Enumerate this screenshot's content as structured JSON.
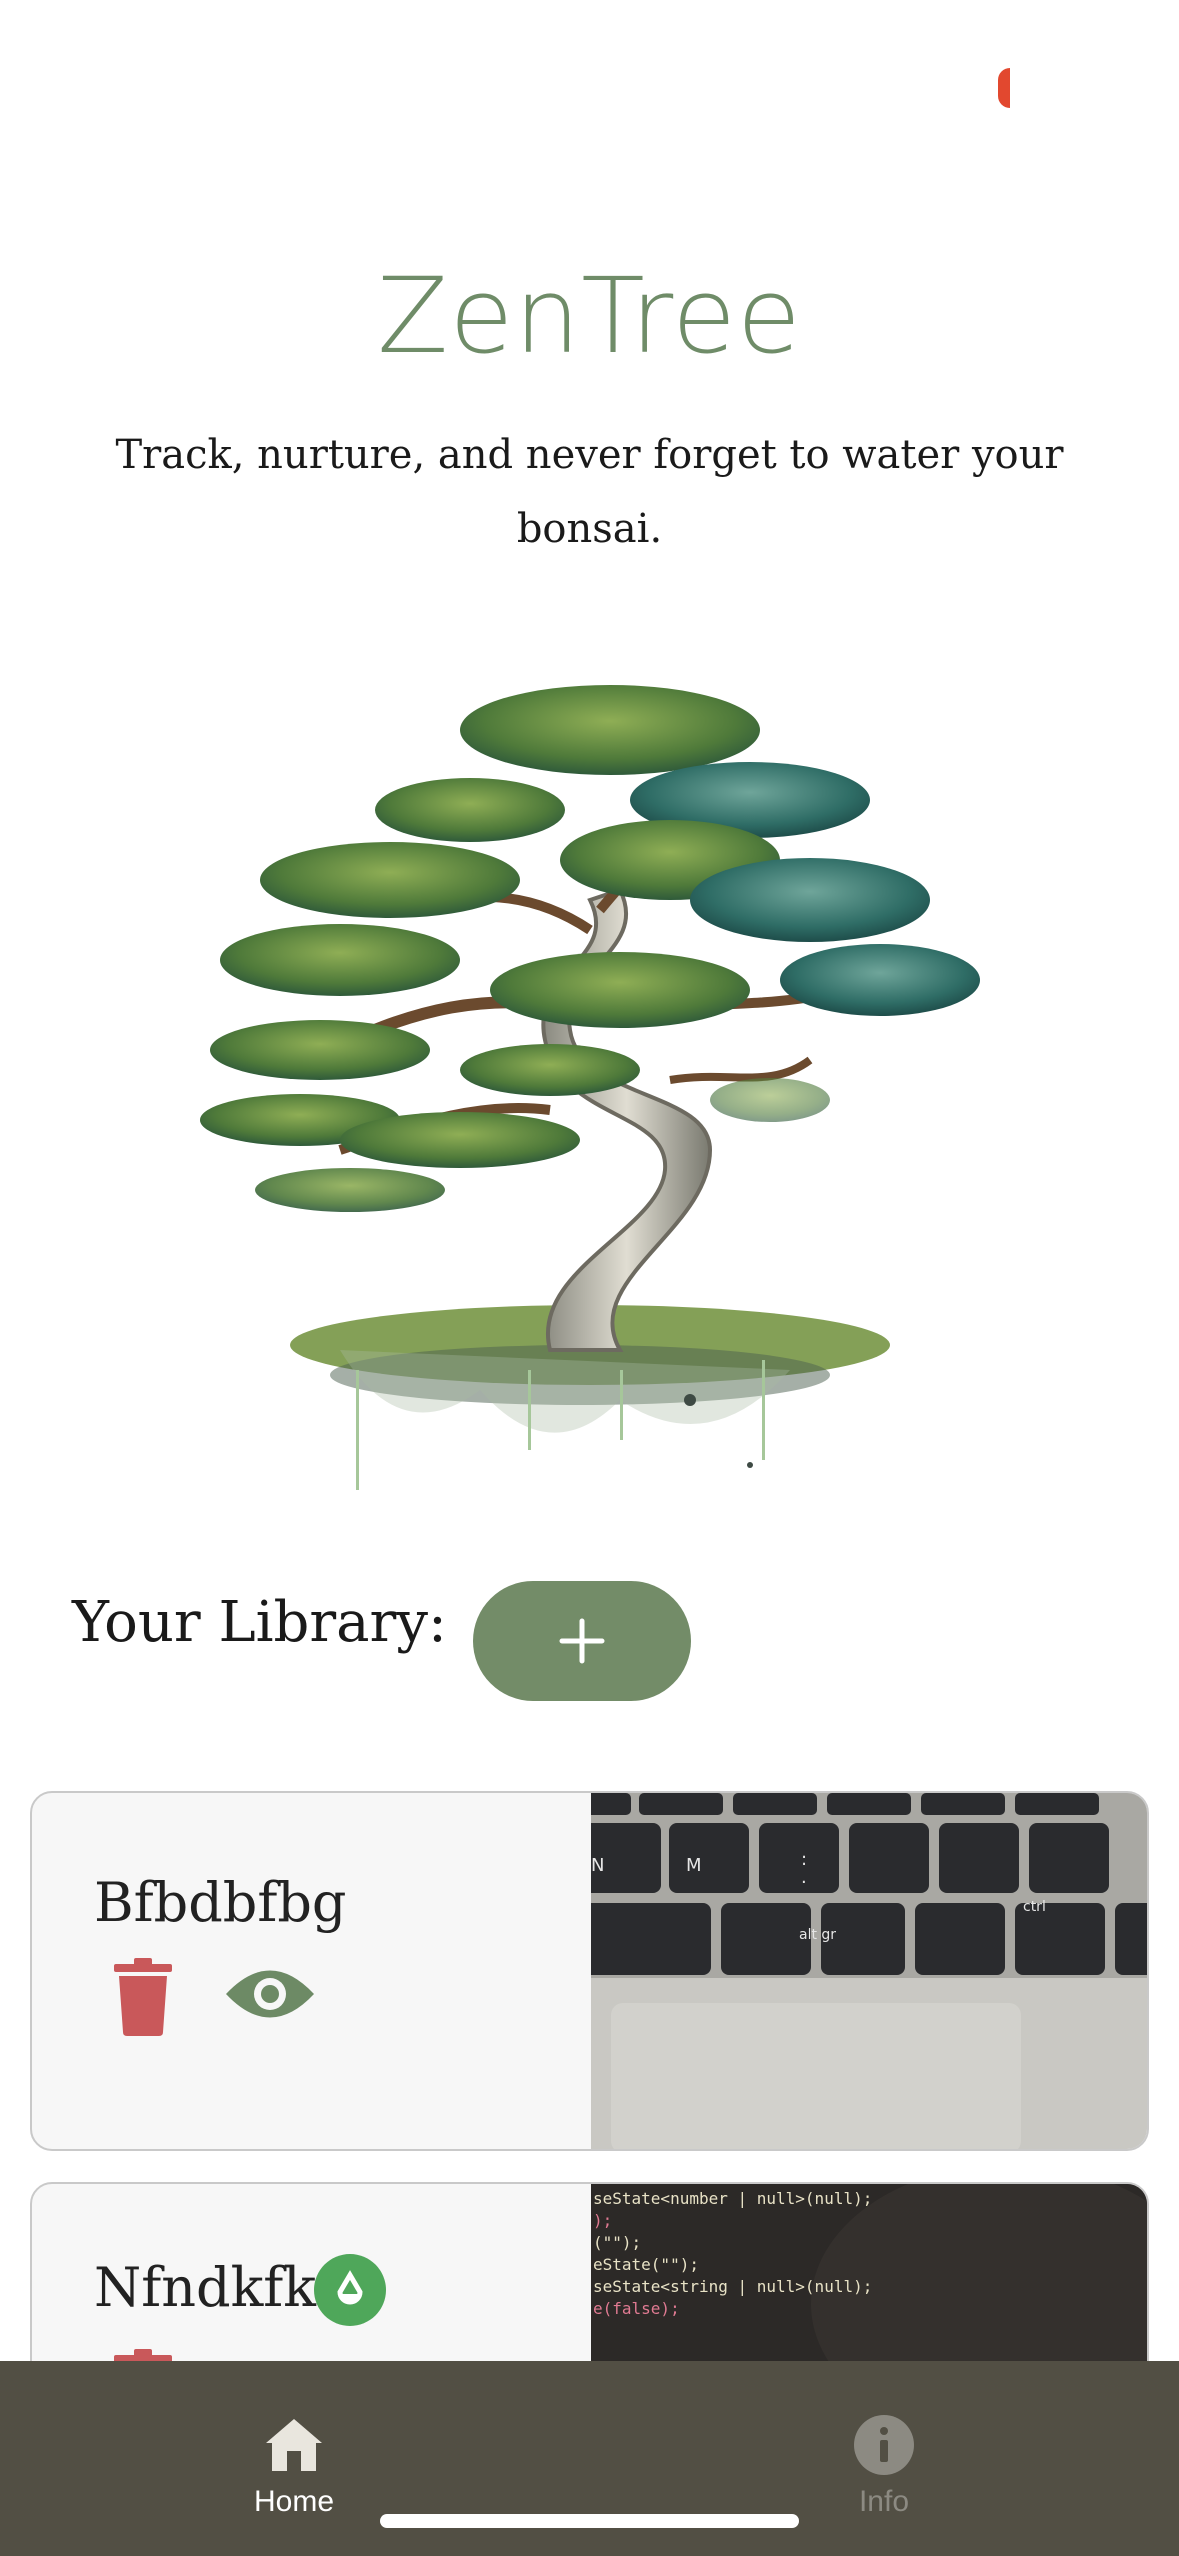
{
  "header": {
    "title": "ZenTree",
    "tagline": "Track, nurture, and never forget to water your bonsai."
  },
  "hero": {
    "image": "bonsai-tree-watercolor"
  },
  "library": {
    "label": "Your Library:",
    "add_button_icon": "plus-icon",
    "items": [
      {
        "name": "Bfbdbfbg",
        "photo": "laptop-keyboard-photo",
        "needs_water": false
      },
      {
        "name": "Nfndkfk",
        "photo": "code-editor-photo",
        "needs_water": true
      }
    ]
  },
  "nav": {
    "items": [
      {
        "label": "Home",
        "icon": "home-icon",
        "active": true
      },
      {
        "label": "Info",
        "icon": "info-icon",
        "active": false
      }
    ]
  },
  "colors": {
    "accent": "#738c68",
    "title": "#6f8c68",
    "delete": "#c9585a",
    "view": "#6d8a65",
    "water": "#4fa75a",
    "nav_bg": "#524f44"
  },
  "code_snippet": [
    "seState<number | null>(null);",
    ");",
    "(\"\");",
    "eState(\"\");",
    "seState<string | null>(null);",
    "e(false);"
  ],
  "keyboard_keys": [
    "N",
    "M",
    ":",
    ".",
    "alt gr",
    "ctrl"
  ]
}
